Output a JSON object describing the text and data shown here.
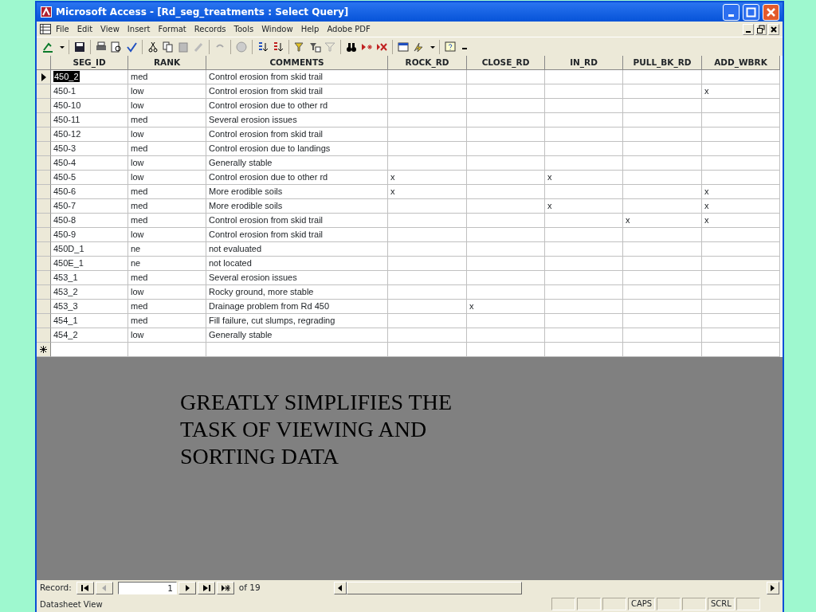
{
  "window": {
    "title": "Microsoft Access - [Rd_seg_treatments : Select Query]"
  },
  "menu": [
    "File",
    "Edit",
    "View",
    "Insert",
    "Format",
    "Records",
    "Tools",
    "Window",
    "Help",
    "Adobe PDF"
  ],
  "table": {
    "columns": [
      "SEG_ID",
      "RANK",
      "COMMENTS",
      "ROCK_RD",
      "CLOSE_RD",
      "IN_RD",
      "PULL_BK_RD",
      "ADD_WBRK"
    ],
    "rows": [
      {
        "current": true,
        "cells": [
          "450_2",
          "med",
          "Control erosion from skid trail",
          "",
          "",
          "",
          "",
          ""
        ]
      },
      {
        "current": false,
        "cells": [
          "450-1",
          "low",
          "Control erosion from skid trail",
          "",
          "",
          "",
          "",
          "x"
        ]
      },
      {
        "current": false,
        "cells": [
          "450-10",
          "low",
          "Control erosion due to other rd",
          "",
          "",
          "",
          "",
          ""
        ]
      },
      {
        "current": false,
        "cells": [
          "450-11",
          "med",
          "Several erosion issues",
          "",
          "",
          "",
          "",
          ""
        ]
      },
      {
        "current": false,
        "cells": [
          "450-12",
          "low",
          "Control erosion from skid trail",
          "",
          "",
          "",
          "",
          ""
        ]
      },
      {
        "current": false,
        "cells": [
          "450-3",
          "med",
          "Control erosion due to landings",
          "",
          "",
          "",
          "",
          ""
        ]
      },
      {
        "current": false,
        "cells": [
          "450-4",
          "low",
          "Generally stable",
          "",
          "",
          "",
          "",
          ""
        ]
      },
      {
        "current": false,
        "cells": [
          "450-5",
          "low",
          "Control erosion due to other rd",
          "x",
          "",
          "x",
          "",
          ""
        ]
      },
      {
        "current": false,
        "cells": [
          "450-6",
          "med",
          "More erodible soils",
          "x",
          "",
          "",
          "",
          "x"
        ]
      },
      {
        "current": false,
        "cells": [
          "450-7",
          "med",
          "More erodible soils",
          "",
          "",
          "x",
          "",
          "x"
        ]
      },
      {
        "current": false,
        "cells": [
          "450-8",
          "med",
          "Control erosion from skid trail",
          "",
          "",
          "",
          "x",
          "x"
        ]
      },
      {
        "current": false,
        "cells": [
          "450-9",
          "low",
          "Control erosion from skid trail",
          "",
          "",
          "",
          "",
          ""
        ]
      },
      {
        "current": false,
        "cells": [
          "450D_1",
          "ne",
          "not evaluated",
          "",
          "",
          "",
          "",
          ""
        ]
      },
      {
        "current": false,
        "cells": [
          "450E_1",
          "ne",
          "not located",
          "",
          "",
          "",
          "",
          ""
        ]
      },
      {
        "current": false,
        "cells": [
          "453_1",
          "med",
          "Several erosion issues",
          "",
          "",
          "",
          "",
          ""
        ]
      },
      {
        "current": false,
        "cells": [
          "453_2",
          "low",
          "Rocky ground, more stable",
          "",
          "",
          "",
          "",
          ""
        ]
      },
      {
        "current": false,
        "cells": [
          "453_3",
          "med",
          "Drainage problem from Rd 450",
          "",
          "x",
          "",
          "",
          ""
        ]
      },
      {
        "current": false,
        "cells": [
          "454_1",
          "med",
          "Fill failure, cut slumps, regrading",
          "",
          "",
          "",
          "",
          ""
        ]
      },
      {
        "current": false,
        "cells": [
          "454_2",
          "low",
          "Generally stable",
          "",
          "",
          "",
          "",
          ""
        ]
      }
    ]
  },
  "slide_text": [
    "GREATLY SIMPLIFIES THE",
    "TASK OF VIEWING AND",
    "SORTING DATA"
  ],
  "navigator": {
    "label": "Record:",
    "value": "1",
    "total": "of 19"
  },
  "status_bar": {
    "text": "Datasheet View",
    "panels": [
      {
        "kind": "blank"
      },
      {
        "kind": "blank"
      },
      {
        "kind": "blank"
      },
      {
        "kind": "lock",
        "label": "CAPS"
      },
      {
        "kind": "blank"
      },
      {
        "kind": "blank"
      },
      {
        "kind": "lock",
        "label": "SCRL"
      },
      {
        "kind": "blank"
      }
    ]
  }
}
